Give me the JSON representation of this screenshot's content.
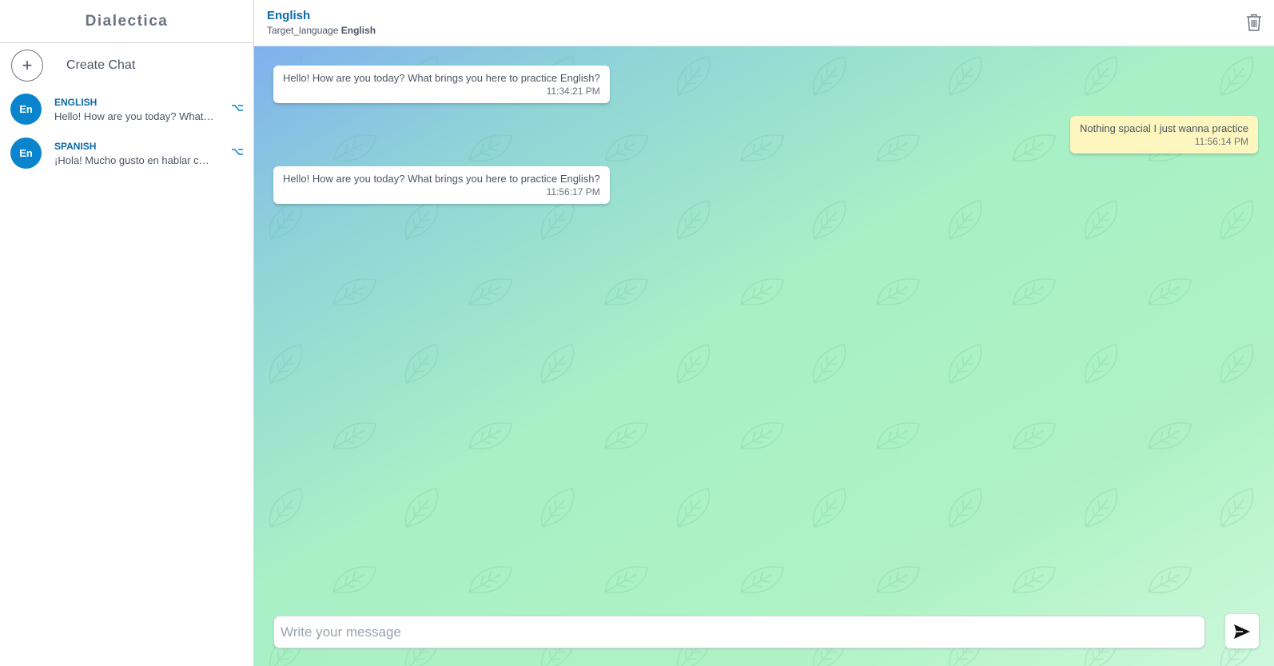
{
  "app": {
    "brand": "Dialectica"
  },
  "sidebar": {
    "create_chat_label": "Create Chat",
    "chats": [
      {
        "avatar": "En",
        "name": "ENGLISH",
        "preview": "Hello! How are you today? What brings you here to practice English?"
      },
      {
        "avatar": "En",
        "name": "SPANISH",
        "preview": "¡Hola! Mucho gusto en hablar contigo."
      }
    ]
  },
  "header": {
    "title": "English",
    "target_label": "Target_language",
    "target_value": "English"
  },
  "messages": [
    {
      "role": "bot",
      "text": "Hello! How are you today? What brings you here to practice English?",
      "time": "11:34:21 PM"
    },
    {
      "role": "user",
      "text": "Nothing spacial I just wanna practice",
      "time": "11:56:14 PM"
    },
    {
      "role": "bot",
      "text": "Hello! How are you today? What brings you here to practice English?",
      "time": "11:56:17 PM"
    }
  ],
  "composer": {
    "placeholder": "Write your message"
  },
  "icons": {
    "create": "plus-icon",
    "chat_menu": "option-icon",
    "delete": "trash-icon",
    "send": "send-icon",
    "background": "leaf-icon"
  },
  "colors": {
    "accent": "#0a84cc",
    "title": "#0b6aa6",
    "user_bubble": "#fdf6bf",
    "bot_bubble": "#ffffff"
  }
}
